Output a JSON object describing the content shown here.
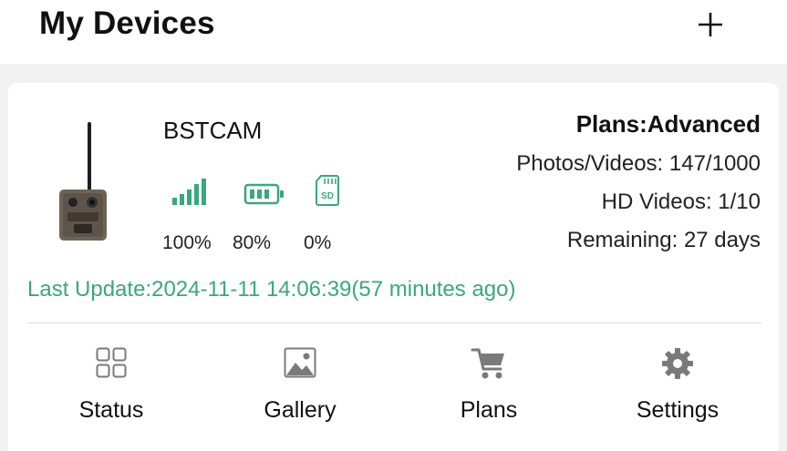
{
  "header": {
    "title": "My Devices",
    "add_icon": "plus-icon"
  },
  "device": {
    "name": "BSTCAM",
    "signal_pct": "100%",
    "battery_pct": "80%",
    "sd_pct": "0%",
    "sd_icon_text": "SD",
    "plan_title": "Plans:Advanced",
    "photos_videos": "Photos/Videos: 147/1000",
    "hd_videos": "HD Videos: 1/10",
    "remaining": "Remaining: 27 days",
    "last_update": "Last Update:2024-11-11 14:06:39(57 minutes ago)"
  },
  "nav": {
    "items": [
      {
        "label": "Status",
        "icon": "grid-icon"
      },
      {
        "label": "Gallery",
        "icon": "image-icon"
      },
      {
        "label": "Plans",
        "icon": "cart-icon"
      },
      {
        "label": "Settings",
        "icon": "gear-icon"
      }
    ]
  },
  "colors": {
    "accent": "#3aa87a",
    "divider": "#dcdcdc",
    "icon_gray": "#7a7a7a"
  }
}
